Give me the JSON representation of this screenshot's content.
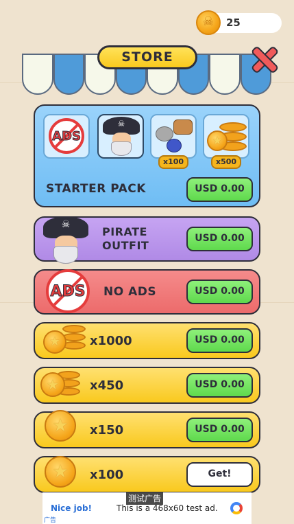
{
  "header": {
    "coin_count": "25",
    "title": "STORE"
  },
  "starter_pack": {
    "title": "STARTER PACK",
    "price": "USD 0.00",
    "items": [
      {
        "icon": "no-ads-icon",
        "badge": ""
      },
      {
        "icon": "pirate-icon",
        "badge": ""
      },
      {
        "icon": "resources-icon",
        "badge": "x100"
      },
      {
        "icon": "coins-icon",
        "badge": "x500"
      }
    ]
  },
  "pirate_outfit": {
    "title_line1": "PIRATE",
    "title_line2": "OUTFIT",
    "price": "USD 0.00"
  },
  "no_ads": {
    "emblem": "ADS",
    "title": "NO ADS",
    "price": "USD 0.00"
  },
  "coin_packs": [
    {
      "amount": "x1000",
      "price": "USD 0.00"
    },
    {
      "amount": "x450",
      "price": "USD 0.00"
    },
    {
      "amount": "x150",
      "price": "USD 0.00"
    },
    {
      "amount": "x100",
      "price": "Get!"
    }
  ],
  "ad": {
    "label": "测试广告",
    "nice": "Nice job!",
    "text": "This is a 468x60 test ad.",
    "small": "广告"
  },
  "colors": {
    "awning_blue": "#4f9bd9",
    "awning_white": "#f4f6ee",
    "green_button": "#6fe05a",
    "gold": "#f9c91e"
  }
}
